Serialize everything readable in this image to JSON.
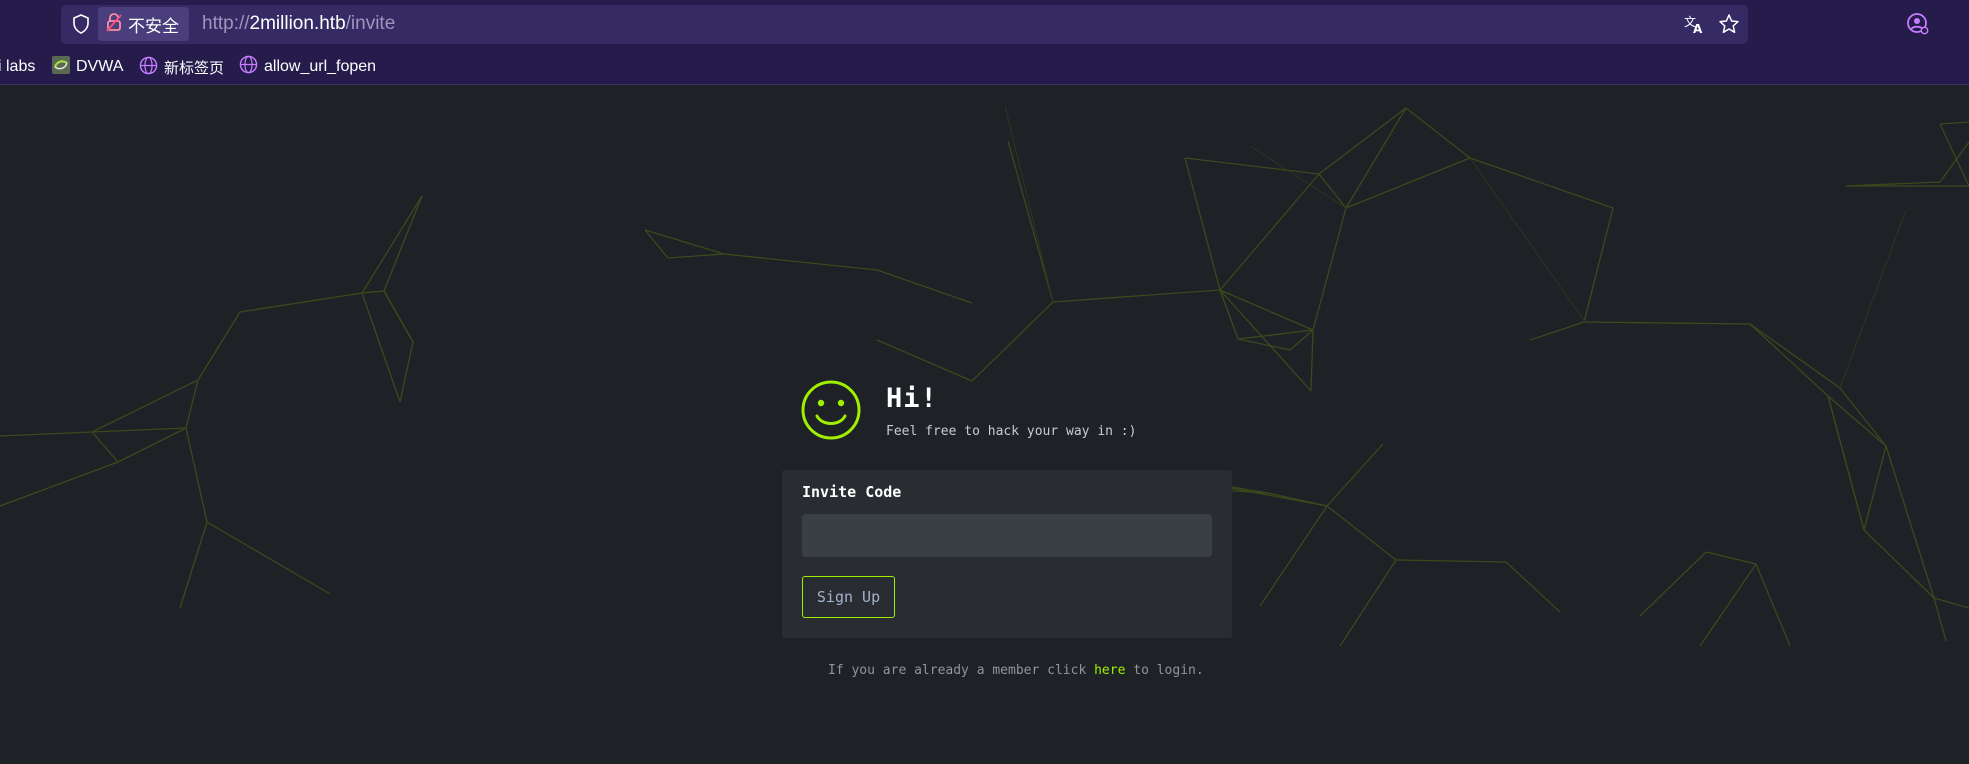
{
  "browser": {
    "security_label": "不安全",
    "url_scheme": "http://",
    "url_host": "2million.htb",
    "url_path": "/invite"
  },
  "bookmarks": [
    {
      "label": "i labs",
      "icon": "none"
    },
    {
      "label": "DVWA",
      "icon": "dvwa-favicon"
    },
    {
      "label": "新标签页",
      "icon": "globe-icon"
    },
    {
      "label": "allow_url_fopen",
      "icon": "globe-icon"
    }
  ],
  "hero": {
    "title": "Hi!",
    "subtitle": "Feel free to hack your way in :)",
    "icon": "smiley-icon"
  },
  "form": {
    "label": "Invite Code",
    "value": "",
    "placeholder": "",
    "submit_label": "Sign Up"
  },
  "login_prompt": {
    "before": "If you are already a member click",
    "link": "here",
    "after": "to login."
  },
  "colors": {
    "accent": "#9fef00",
    "chrome_bg": "#261c4c",
    "page_bg": "#1e2125",
    "card_bg": "#292d31"
  }
}
